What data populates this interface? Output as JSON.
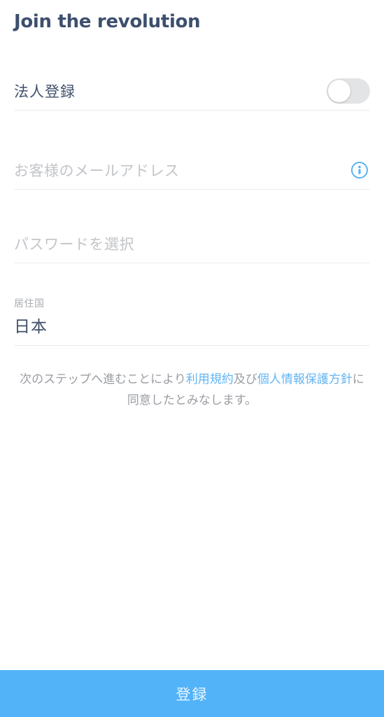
{
  "header": {
    "title": "Join the revolution"
  },
  "form": {
    "corporate_toggle": {
      "label": "法人登録",
      "state": "off"
    },
    "email": {
      "value": "",
      "placeholder": "お客様のメールアドレス",
      "icon": "info-circle-icon"
    },
    "password": {
      "value": "",
      "placeholder": "パスワードを選択"
    },
    "country": {
      "label": "居住国",
      "value": "日本"
    }
  },
  "terms": {
    "prefix": "次のステップへ進むことにより",
    "link_terms": "利用規約",
    "middle": "及び",
    "link_privacy": "個人情報保護方針",
    "suffix": "に同意したとみなします。"
  },
  "submit": {
    "label": "登録"
  },
  "colors": {
    "title": "#3d4f6d",
    "accent_blue": "#53b3f8",
    "link_blue": "#62b5f4",
    "placeholder_gray": "#c2c5c9",
    "divider": "#ebecee",
    "toggle_track": "#e3e4e5"
  }
}
